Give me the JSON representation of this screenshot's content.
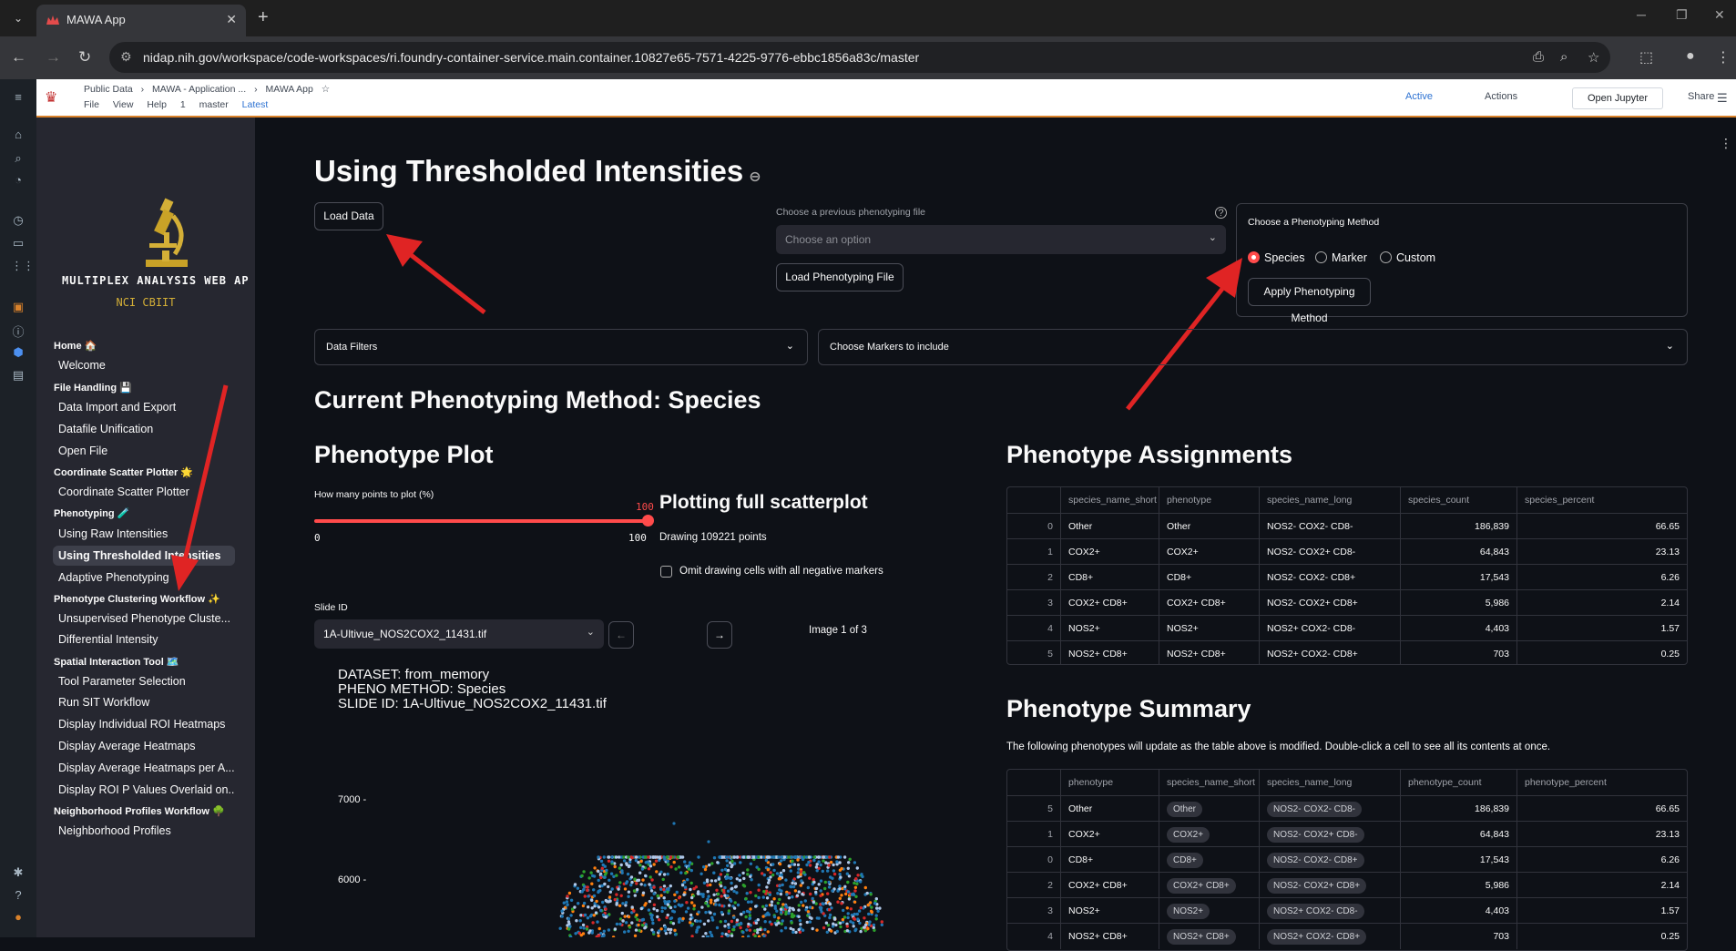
{
  "browser": {
    "tab_title": "MAWA App",
    "url": "nidap.nih.gov/workspace/code-workspaces/ri.foundry-container-service.main.container.10827e65-7571-4225-9776-ebbc1856a83c/master"
  },
  "foundry_header": {
    "breadcrumb": [
      "Public Data",
      "MAWA - Application ...",
      "MAWA App"
    ],
    "menus": [
      "File",
      "View",
      "Help"
    ],
    "branch": "master",
    "version": "Latest",
    "count": "1",
    "status": "Active",
    "actions_label": "Actions",
    "open_jupyter_label": "Open Jupyter",
    "share_label": "Share"
  },
  "sidebar": {
    "logo_title": "MULTIPLEX ANALYSIS WEB AP",
    "logo_subtitle": "NCI CBIIT",
    "sections": [
      {
        "title": "Home 🏠",
        "items": [
          "Welcome"
        ]
      },
      {
        "title": "File Handling 💾",
        "items": [
          "Data Import and Export",
          "Datafile Unification",
          "Open File"
        ]
      },
      {
        "title": "Coordinate Scatter Plotter 🌟",
        "items": [
          "Coordinate Scatter Plotter"
        ]
      },
      {
        "title": "Phenotyping 🧪",
        "items": [
          "Using Raw Intensities",
          "Using Thresholded Intensities",
          "Adaptive Phenotyping"
        ]
      },
      {
        "title": "Phenotype Clustering Workflow ✨",
        "items": [
          "Unsupervised Phenotype Cluste...",
          "Differential Intensity"
        ]
      },
      {
        "title": "Spatial Interaction Tool 🗺️",
        "items": [
          "Tool Parameter Selection",
          "Run SIT Workflow",
          "Display Individual ROI Heatmaps",
          "Display Average Heatmaps",
          "Display Average Heatmaps per A...",
          "Display ROI P Values Overlaid on..."
        ]
      },
      {
        "title": "Neighborhood Profiles Workflow 🌳",
        "items": [
          "Neighborhood Profiles"
        ]
      }
    ],
    "active_item": "Using Thresholded Intensities"
  },
  "main": {
    "title": "Using Thresholded Intensities",
    "load_data_label": "Load Data",
    "prev_file_label": "Choose a previous phenotyping file",
    "prev_file_placeholder": "Choose an option",
    "load_pheno_file_label": "Load Phenotyping File",
    "method_box_label": "Choose a Phenotyping Method",
    "methods": [
      "Species",
      "Marker",
      "Custom"
    ],
    "selected_method": "Species",
    "apply_method_label": "Apply Phenotyping Method",
    "data_filters_label": "Data Filters",
    "choose_markers_label": "Choose Markers to include",
    "current_method_heading": "Current Phenotyping Method: Species",
    "phenotype_plot_heading": "Phenotype Plot",
    "points_slider_label": "How many points to plot (%)",
    "slider_value": "100",
    "slider_min": "0",
    "slider_max": "100",
    "plotting_heading": "Plotting full scatterplot",
    "drawing_text": "Drawing 109221 points",
    "omit_checkbox_label": "Omit drawing cells with all negative markers",
    "slide_id_label": "Slide ID",
    "slide_id_value": "1A-Ultivue_NOS2COX2_11431.tif",
    "prev_arrow": "←",
    "next_arrow": "→",
    "image_counter": "Image 1 of 3",
    "plot_info": "DATASET: from_memory\nPHENO METHOD: Species\nSLIDE ID: 1A-Ultivue_NOS2COX2_11431.tif",
    "y_ticks": [
      "7000 -",
      "6000 -"
    ]
  },
  "assignments": {
    "heading": "Phenotype Assignments",
    "columns": [
      "",
      "species_name_short",
      "phenotype",
      "species_name_long",
      "species_count",
      "species_percent"
    ],
    "rows": [
      [
        "0",
        "Other",
        "Other",
        "NOS2- COX2- CD8-",
        "186,839",
        "66.65"
      ],
      [
        "1",
        "COX2+",
        "COX2+",
        "NOS2- COX2+ CD8-",
        "64,843",
        "23.13"
      ],
      [
        "2",
        "CD8+",
        "CD8+",
        "NOS2- COX2- CD8+",
        "17,543",
        "6.26"
      ],
      [
        "3",
        "COX2+ CD8+",
        "COX2+ CD8+",
        "NOS2- COX2+ CD8+",
        "5,986",
        "2.14"
      ],
      [
        "4",
        "NOS2+",
        "NOS2+",
        "NOS2+ COX2- CD8-",
        "4,403",
        "1.57"
      ],
      [
        "5",
        "NOS2+ CD8+",
        "NOS2+ CD8+",
        "NOS2+ COX2- CD8+",
        "703",
        "0.25"
      ]
    ]
  },
  "summary": {
    "heading": "Phenotype Summary",
    "description": "The following phenotypes will update as the table above is modified. Double-click a cell to see all its contents at once.",
    "columns": [
      "",
      "phenotype",
      "species_name_short",
      "species_name_long",
      "phenotype_count",
      "phenotype_percent"
    ],
    "rows": [
      [
        "5",
        "Other",
        "Other",
        "NOS2- COX2- CD8-",
        "186,839",
        "66.65"
      ],
      [
        "1",
        "COX2+",
        "COX2+",
        "NOS2- COX2+ CD8-",
        "64,843",
        "23.13"
      ],
      [
        "0",
        "CD8+",
        "CD8+",
        "NOS2- COX2- CD8+",
        "17,543",
        "6.26"
      ],
      [
        "2",
        "COX2+ CD8+",
        "COX2+ CD8+",
        "NOS2- COX2+ CD8+",
        "5,986",
        "2.14"
      ],
      [
        "3",
        "NOS2+",
        "NOS2+",
        "NOS2+ COX2- CD8-",
        "4,403",
        "1.57"
      ],
      [
        "4",
        "NOS2+ CD8+",
        "NOS2+ CD8+",
        "NOS2+ COX2- CD8+",
        "703",
        "0.25"
      ]
    ]
  },
  "colors": {
    "accent": "#ff4b4b",
    "annotation_arrow": "#e02424",
    "background": "#0e1117",
    "sidebar": "#262730"
  }
}
